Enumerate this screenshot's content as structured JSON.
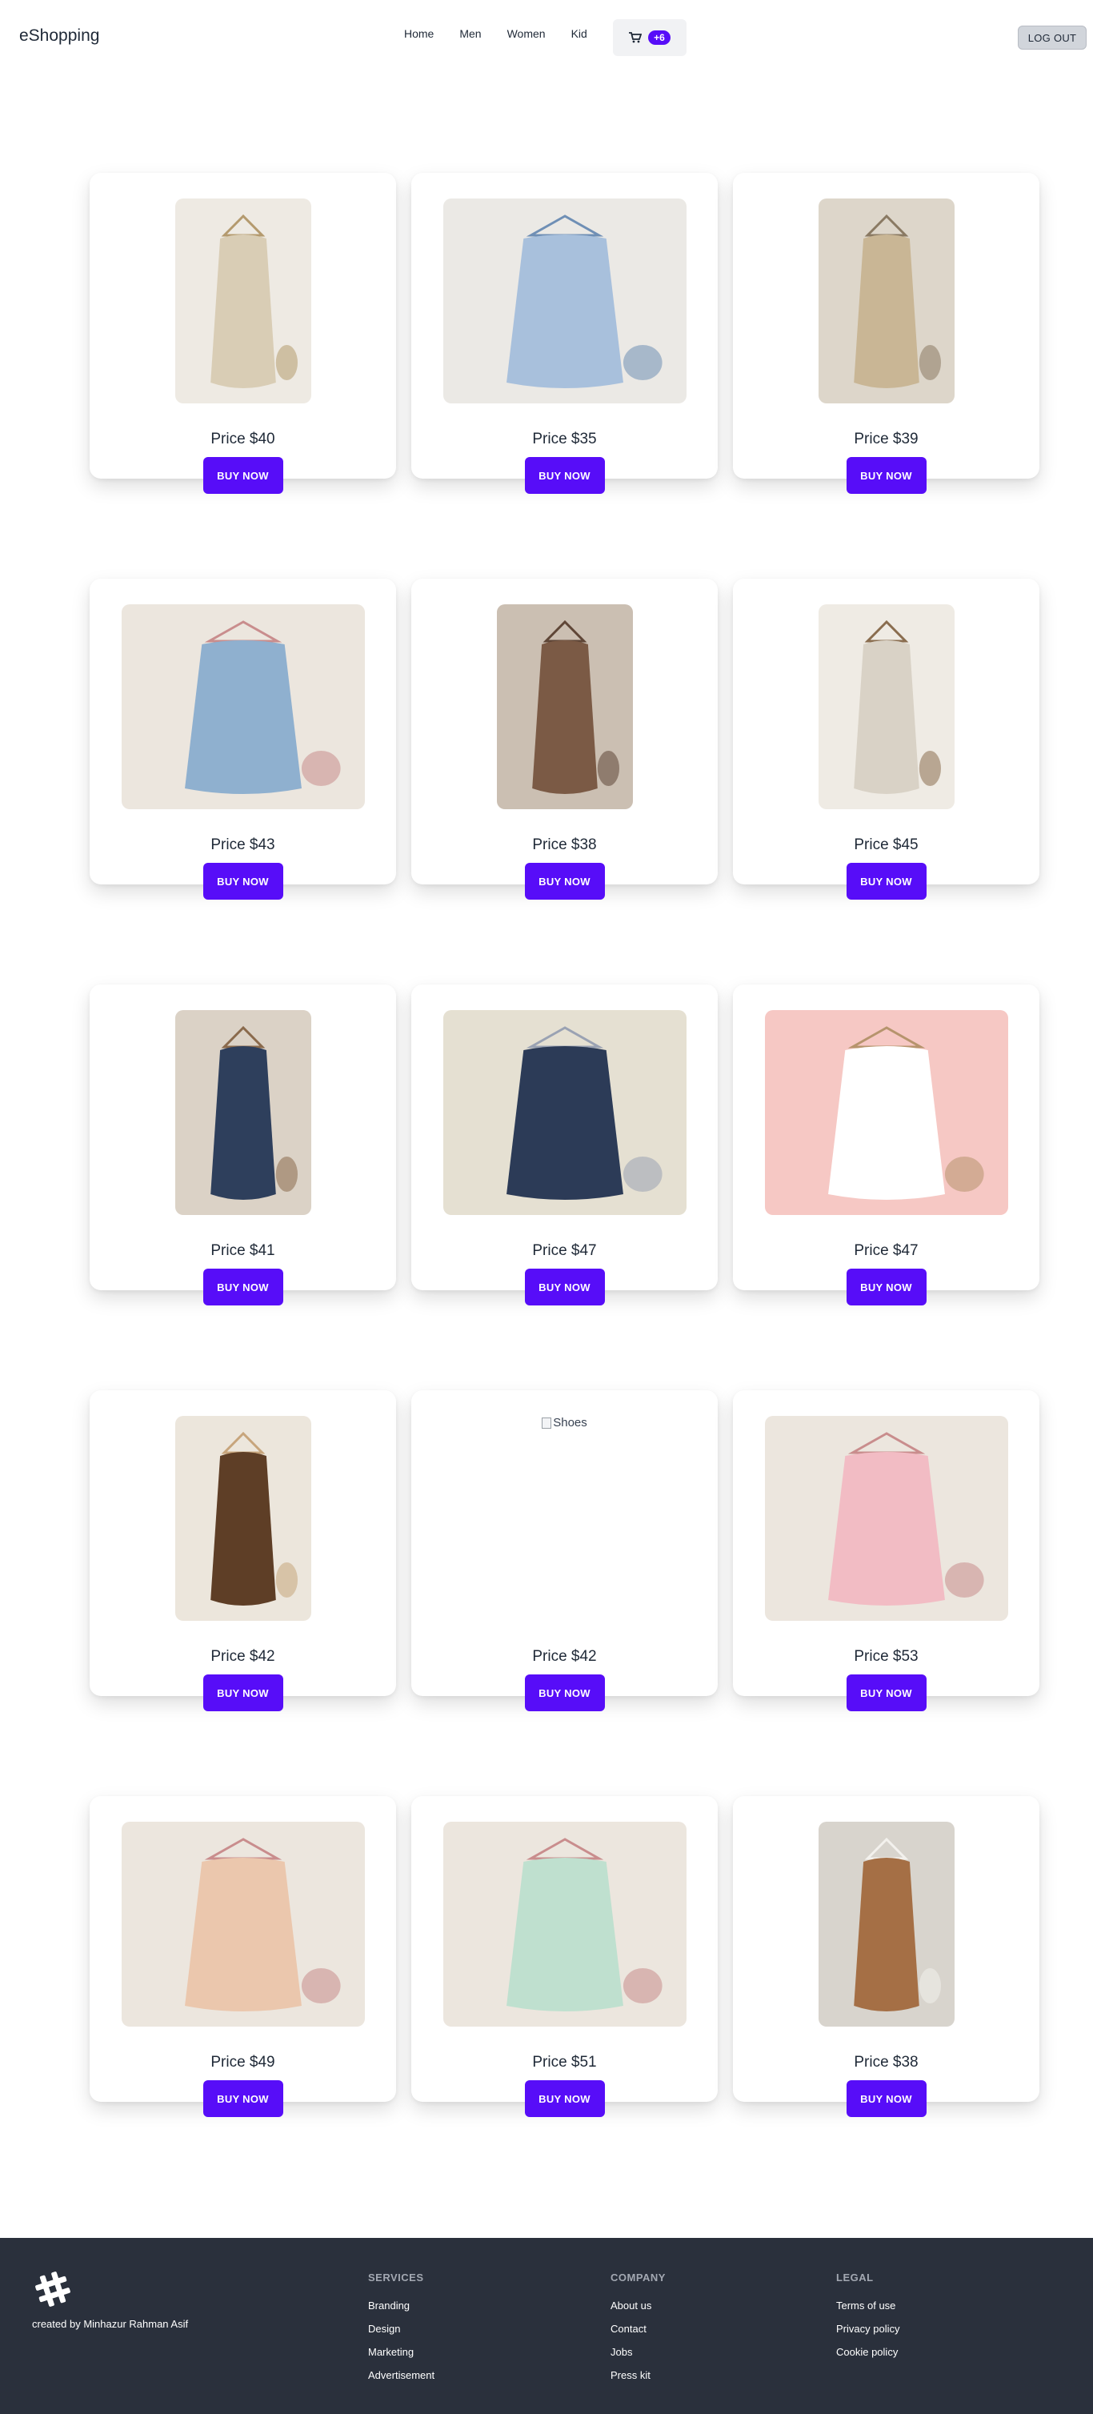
{
  "navbar": {
    "brand": "eShopping",
    "menu": [
      {
        "label": "Home"
      },
      {
        "label": "Men"
      },
      {
        "label": "Women"
      },
      {
        "label": "Kid"
      }
    ],
    "cart_badge": "+6",
    "logout_label": "LOG OUT"
  },
  "products": [
    {
      "price": "Price $40",
      "button": "BUY NOW",
      "alt": "",
      "shape": "portrait",
      "palette": [
        "#eeeae3",
        "#d9cdb5",
        "#b49a6e"
      ]
    },
    {
      "price": "Price $35",
      "button": "BUY NOW",
      "alt": "",
      "shape": "landscape",
      "palette": [
        "#ebe9e5",
        "#a8c0dc",
        "#6f8fb5"
      ]
    },
    {
      "price": "Price $39",
      "button": "BUY NOW",
      "alt": "",
      "shape": "portrait",
      "palette": [
        "#ddd6ca",
        "#c9b695",
        "#8a7a63"
      ]
    },
    {
      "price": "Price $43",
      "button": "BUY NOW",
      "alt": "",
      "shape": "landscape",
      "palette": [
        "#ece6de",
        "#8fb0cf",
        "#c98d8d"
      ]
    },
    {
      "price": "Price $38",
      "button": "BUY NOW",
      "alt": "",
      "shape": "portrait",
      "palette": [
        "#cbbfb2",
        "#7b5a45",
        "#5f4637"
      ]
    },
    {
      "price": "Price $45",
      "button": "BUY NOW",
      "alt": "",
      "shape": "portrait",
      "palette": [
        "#efebe4",
        "#d9d2c6",
        "#8a6d4f"
      ]
    },
    {
      "price": "Price $41",
      "button": "BUY NOW",
      "alt": "",
      "shape": "portrait",
      "palette": [
        "#dbd2c6",
        "#2e3f5c",
        "#8a6a4c"
      ]
    },
    {
      "price": "Price $47",
      "button": "BUY NOW",
      "alt": "",
      "shape": "landscape",
      "palette": [
        "#e5e0d2",
        "#2c3b57",
        "#9aa2b3"
      ]
    },
    {
      "price": "Price $47",
      "button": "BUY NOW",
      "alt": "",
      "shape": "landscape",
      "palette": [
        "#f6c8c4",
        "#ffffff",
        "#b6946d"
      ]
    },
    {
      "price": "Price $42",
      "button": "BUY NOW",
      "alt": "",
      "shape": "portrait",
      "palette": [
        "#ece6dc",
        "#5e3e26",
        "#c7a57c"
      ]
    },
    {
      "price": "Price $42",
      "button": "BUY NOW",
      "alt": "Shoes",
      "shape": "broken",
      "palette": [
        "#ffffff",
        "#ffffff",
        "#ffffff"
      ]
    },
    {
      "price": "Price $53",
      "button": "BUY NOW",
      "alt": "",
      "shape": "landscape",
      "palette": [
        "#ece6de",
        "#f2bcc4",
        "#c98d8d"
      ]
    },
    {
      "price": "Price $49",
      "button": "BUY NOW",
      "alt": "",
      "shape": "landscape",
      "palette": [
        "#ece6de",
        "#ebc7ad",
        "#c98d8d"
      ]
    },
    {
      "price": "Price $51",
      "button": "BUY NOW",
      "alt": "",
      "shape": "landscape",
      "palette": [
        "#ece6de",
        "#bfe0cf",
        "#c98d8d"
      ]
    },
    {
      "price": "Price $38",
      "button": "BUY NOW",
      "alt": "",
      "shape": "portrait",
      "palette": [
        "#d8d4cd",
        "#a56f45",
        "#f3f1ed"
      ]
    }
  ],
  "footer": {
    "credit": "created by Minhazur Rahman Asif",
    "columns": [
      {
        "title": "SERVICES",
        "links": [
          "Branding",
          "Design",
          "Marketing",
          "Advertisement"
        ]
      },
      {
        "title": "COMPANY",
        "links": [
          "About us",
          "Contact",
          "Jobs",
          "Press kit"
        ]
      },
      {
        "title": "LEGAL",
        "links": [
          "Terms of use",
          "Privacy policy",
          "Cookie policy"
        ]
      }
    ]
  },
  "colors": {
    "primary": "#570df8",
    "footer_bg": "#2a303c"
  }
}
